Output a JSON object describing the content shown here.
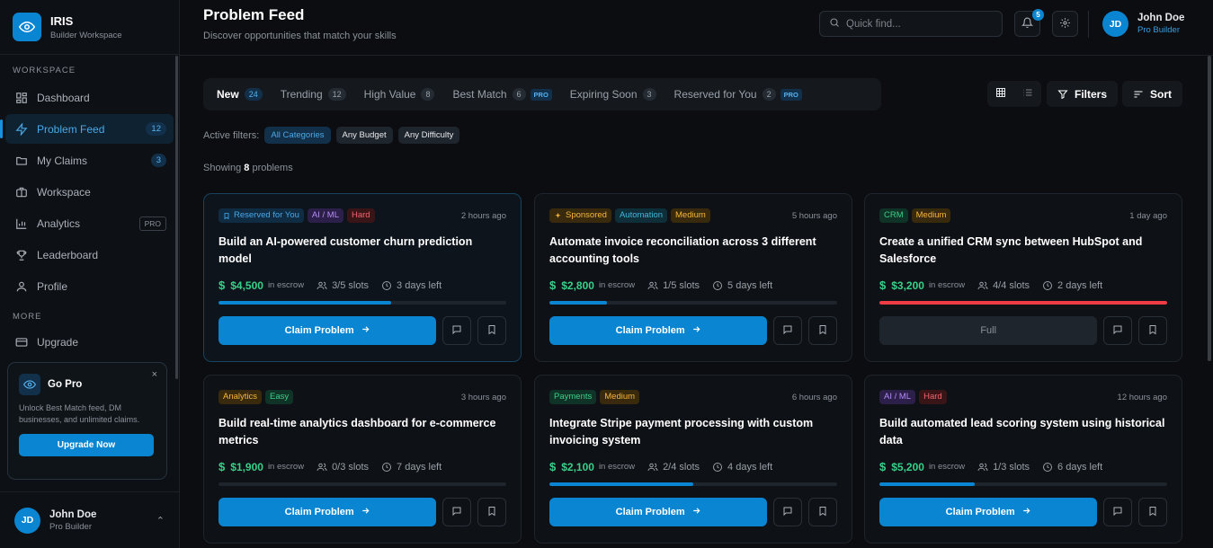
{
  "brand": {
    "name": "IRIS",
    "subtitle": "Builder Workspace"
  },
  "sidebar": {
    "workspace_label": "WORKSPACE",
    "items": [
      {
        "label": "Dashboard",
        "icon": "dashboard-icon"
      },
      {
        "label": "Problem Feed",
        "icon": "lightning-icon",
        "badge": "12"
      },
      {
        "label": "My Claims",
        "icon": "folder-icon",
        "badge": "3"
      },
      {
        "label": "Workspace",
        "icon": "briefcase-icon"
      },
      {
        "label": "Analytics",
        "icon": "chart-icon",
        "pro": "PRO"
      },
      {
        "label": "Leaderboard",
        "icon": "trophy-icon"
      },
      {
        "label": "Profile",
        "icon": "user-icon"
      }
    ],
    "more_label": "MORE",
    "upgrade_label": "Upgrade"
  },
  "gopro": {
    "title": "Go Pro",
    "close": "×",
    "description": "Unlock Best Match feed, DM businesses, and unlimited claims.",
    "button": "Upgrade Now"
  },
  "user": {
    "initials": "JD",
    "name": "John Doe",
    "role": "Pro Builder",
    "chevron": "⌃"
  },
  "header": {
    "title": "Problem Feed",
    "subtitle": "Discover opportunities that match your skills",
    "search_placeholder": "Quick find...",
    "notification_count": "5"
  },
  "tabs": [
    {
      "label": "New",
      "count": "24",
      "active": true
    },
    {
      "label": "Trending",
      "count": "12"
    },
    {
      "label": "High Value",
      "count": "8"
    },
    {
      "label": "Best Match",
      "count": "6",
      "pro": "PRO"
    },
    {
      "label": "Expiring Soon",
      "count": "3"
    },
    {
      "label": "Reserved for You",
      "count": "2",
      "pro": "PRO"
    }
  ],
  "toolbar": {
    "filters_label": "Filters",
    "sort_label": "Sort"
  },
  "filters": {
    "label": "Active filters:",
    "chips": [
      "All Categories",
      "Any Budget",
      "Any Difficulty"
    ]
  },
  "showing": {
    "prefix": "Showing",
    "count": "8",
    "suffix": "problems"
  },
  "cards": [
    {
      "tags": [
        {
          "text": "Reserved for You",
          "color": "blue",
          "icon": "bookmark-icon"
        },
        {
          "text": "AI / ML",
          "color": "purple"
        },
        {
          "text": "Hard",
          "color": "red"
        }
      ],
      "time": "2 hours ago",
      "title": "Build an AI-powered customer churn prediction model",
      "price": "$4,500",
      "escrow": "in escrow",
      "slots": "3/5 slots",
      "deadline": "3 days left",
      "progress": 0.6,
      "button": "Claim Problem",
      "featured": true
    },
    {
      "tags": [
        {
          "text": "Sponsored",
          "color": "orange",
          "icon": "sparkle-icon"
        },
        {
          "text": "Automation",
          "color": "teal"
        },
        {
          "text": "Medium",
          "color": "orange"
        }
      ],
      "time": "5 hours ago",
      "title": "Automate invoice reconciliation across 3 different accounting tools",
      "price": "$2,800",
      "escrow": "in escrow",
      "slots": "1/5 slots",
      "deadline": "5 days left",
      "progress": 0.2,
      "button": "Claim Problem"
    },
    {
      "tags": [
        {
          "text": "CRM",
          "color": "green"
        },
        {
          "text": "Medium",
          "color": "orange"
        }
      ],
      "time": "1 day ago",
      "title": "Create a unified CRM sync between HubSpot and Salesforce",
      "price": "$3,200",
      "escrow": "in escrow",
      "slots": "4/4 slots",
      "deadline": "2 days left",
      "progress": 1.0,
      "button": "Full",
      "full": true
    },
    {
      "tags": [
        {
          "text": "Analytics",
          "color": "orange"
        },
        {
          "text": "Easy",
          "color": "green"
        }
      ],
      "time": "3 hours ago",
      "title": "Build real-time analytics dashboard for e-commerce metrics",
      "price": "$1,900",
      "escrow": "in escrow",
      "slots": "0/3 slots",
      "deadline": "7 days left",
      "progress": 0.0,
      "button": "Claim Problem"
    },
    {
      "tags": [
        {
          "text": "Payments",
          "color": "green"
        },
        {
          "text": "Medium",
          "color": "orange"
        }
      ],
      "time": "6 hours ago",
      "title": "Integrate Stripe payment processing with custom invoicing system",
      "price": "$2,100",
      "escrow": "in escrow",
      "slots": "2/4 slots",
      "deadline": "4 days left",
      "progress": 0.5,
      "button": "Claim Problem"
    },
    {
      "tags": [
        {
          "text": "AI / ML",
          "color": "purple"
        },
        {
          "text": "Hard",
          "color": "red"
        }
      ],
      "time": "12 hours ago",
      "title": "Build automated lead scoring system using historical data",
      "price": "$5,200",
      "escrow": "in escrow",
      "slots": "1/3 slots",
      "deadline": "6 days left",
      "progress": 0.33,
      "button": "Claim Problem"
    }
  ]
}
